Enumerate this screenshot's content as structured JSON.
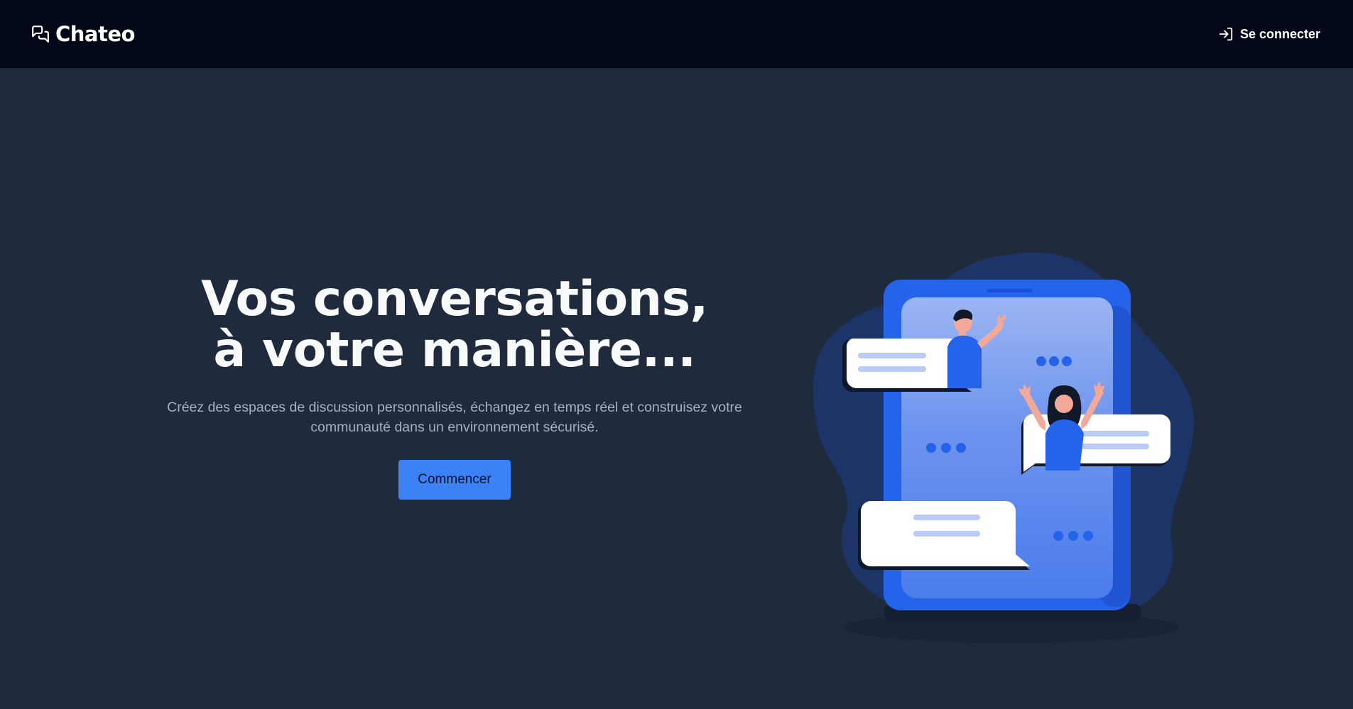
{
  "header": {
    "brand_name": "Chateo",
    "login_label": "Se connecter"
  },
  "hero": {
    "title_line1": "Vos conversations,",
    "title_line2": "à votre manière...",
    "subtitle": "Créez des espaces de discussion personnalisés, échangez en temps réel et construisez votre communauté dans un environnement sécurisé.",
    "cta_label": "Commencer"
  },
  "icons": {
    "brand": "chat-bubbles-icon",
    "login": "log-in-icon"
  },
  "colors": {
    "navbar_bg": "#020817",
    "page_bg": "#1f2a3d",
    "accent": "#3b82f6",
    "title": "#f8fafc",
    "subtitle": "#a7b0bf"
  }
}
